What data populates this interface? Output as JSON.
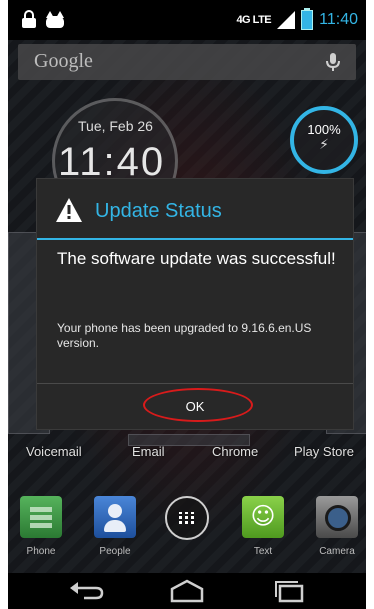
{
  "status_bar": {
    "network": "4G LTE",
    "time": "11:40",
    "icons": [
      "lock-icon",
      "cat-icon",
      "signal-icon",
      "battery-icon"
    ]
  },
  "search_bar": {
    "label": "Google",
    "icon": "mic-icon"
  },
  "clock_widget": {
    "date": "Tue, Feb 26",
    "time": "11:40"
  },
  "battery_widget": {
    "percent": "100%",
    "icon": "bolt-icon",
    "accent": "#33b5e5"
  },
  "dialog": {
    "title": "Update Status",
    "title_icon": "warning-icon",
    "message": "The software update was successful!",
    "detail": "Your phone has been upgraded to 9.16.6.en.US version.",
    "ok_label": "OK",
    "accent": "#33b5e5",
    "highlight_color": "#d81b1b"
  },
  "home_labels": [
    "Voicemail",
    "Email",
    "Chrome",
    "Play Store"
  ],
  "dock": [
    {
      "label": "Phone",
      "icon": "phone-icon"
    },
    {
      "label": "People",
      "icon": "people-icon"
    },
    {
      "label": "",
      "icon": "apps-icon"
    },
    {
      "label": "Text",
      "icon": "text-icon"
    },
    {
      "label": "Camera",
      "icon": "camera-icon"
    }
  ],
  "nav_bar": [
    "back-icon",
    "home-icon",
    "recent-apps-icon"
  ]
}
